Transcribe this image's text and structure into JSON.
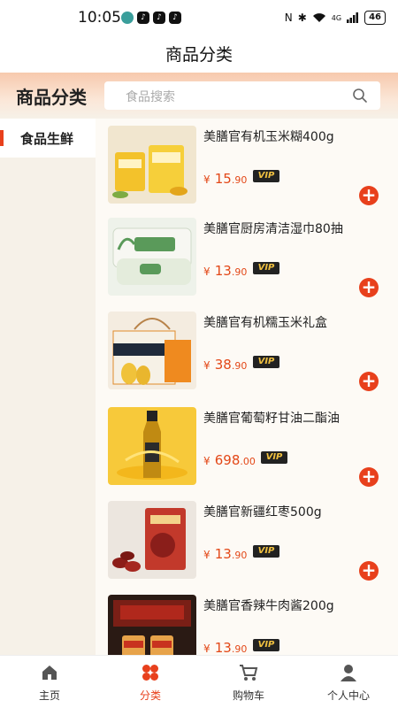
{
  "status_bar": {
    "time": "10:05",
    "battery": "46",
    "signal": "4G"
  },
  "title_bar": {
    "title": "商品分类"
  },
  "header": {
    "title": "商品分类",
    "search_placeholder": "食品搜索"
  },
  "sidebar": {
    "items": [
      {
        "label": "食品生鲜",
        "selected": true
      }
    ]
  },
  "products": [
    {
      "name": "美膳官有机玉米糊400g",
      "currency": "¥",
      "price_int": "15",
      "price_dec": ".90",
      "vip": "VIP",
      "thumb": "yellow-bags"
    },
    {
      "name": "美膳官厨房清洁湿巾80抽",
      "currency": "¥",
      "price_int": "13",
      "price_dec": ".90",
      "vip": "VIP",
      "thumb": "green-wipes"
    },
    {
      "name": "美膳官有机糯玉米礼盒",
      "currency": "¥",
      "price_int": "38",
      "price_dec": ".90",
      "vip": "VIP",
      "thumb": "orange-giftbox"
    },
    {
      "name": "美膳官葡萄籽甘油二酯油",
      "currency": "¥",
      "price_int": "698",
      "price_dec": ".00",
      "vip": "VIP",
      "thumb": "oil-bottle"
    },
    {
      "name": "美膳官新疆红枣500g",
      "currency": "¥",
      "price_int": "13",
      "price_dec": ".90",
      "vip": "VIP",
      "thumb": "red-dates"
    },
    {
      "name": "美膳官香辣牛肉酱200g",
      "currency": "¥",
      "price_int": "13",
      "price_dec": ".90",
      "vip": "VIP",
      "thumb": "beef-sauce"
    }
  ],
  "bottom_nav": {
    "items": [
      {
        "label": "主页",
        "icon": "home-icon"
      },
      {
        "label": "分类",
        "icon": "category-icon",
        "active": true
      },
      {
        "label": "购物车",
        "icon": "cart-icon"
      },
      {
        "label": "个人中心",
        "icon": "person-icon"
      }
    ]
  },
  "colors": {
    "accent": "#e8401c",
    "price": "#e34818",
    "vip_bg": "#222222",
    "vip_text": "#f0c040"
  }
}
